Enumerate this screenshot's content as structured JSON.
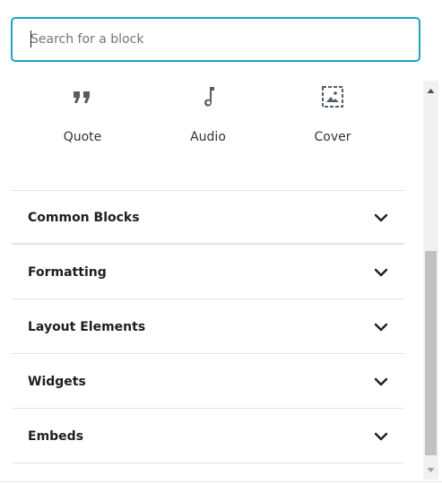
{
  "search": {
    "value": "",
    "placeholder": "Search for a block"
  },
  "blocks": [
    {
      "label": "Quote",
      "icon": "quote-icon"
    },
    {
      "label": "Audio",
      "icon": "audio-icon"
    },
    {
      "label": "Cover",
      "icon": "cover-icon"
    }
  ],
  "panels": [
    {
      "title": "Common Blocks",
      "expanded": false
    },
    {
      "title": "Formatting",
      "expanded": false
    },
    {
      "title": "Layout Elements",
      "expanded": false
    },
    {
      "title": "Widgets",
      "expanded": false
    },
    {
      "title": "Embeds",
      "expanded": false
    }
  ],
  "colors": {
    "accent": "#1ba3c6",
    "text": "#1e1e1e",
    "placeholder": "#757575",
    "divider": "#e2e4e7",
    "icon": "#555d66"
  }
}
